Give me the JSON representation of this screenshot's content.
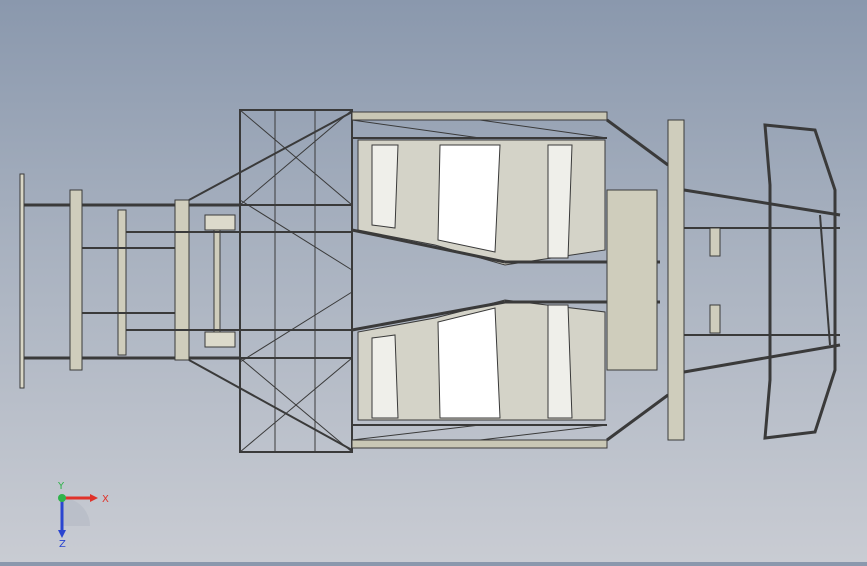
{
  "viewport": {
    "model": "chassis-frame",
    "view": "top",
    "colors": {
      "background_top": "#8a98ad",
      "background_bottom": "#c9ccd3",
      "tube": "#c9c7b5",
      "edge": "#3a3a3a",
      "panel_light": "#efefea",
      "panel_mid": "#d4d3c8",
      "panel_white": "#ffffff"
    }
  },
  "triad": {
    "x_label": "X",
    "y_label": "Y",
    "z_label": "Z",
    "x_color": "#e0322a",
    "y_color": "#2fb34a",
    "z_color": "#2a45d0"
  }
}
